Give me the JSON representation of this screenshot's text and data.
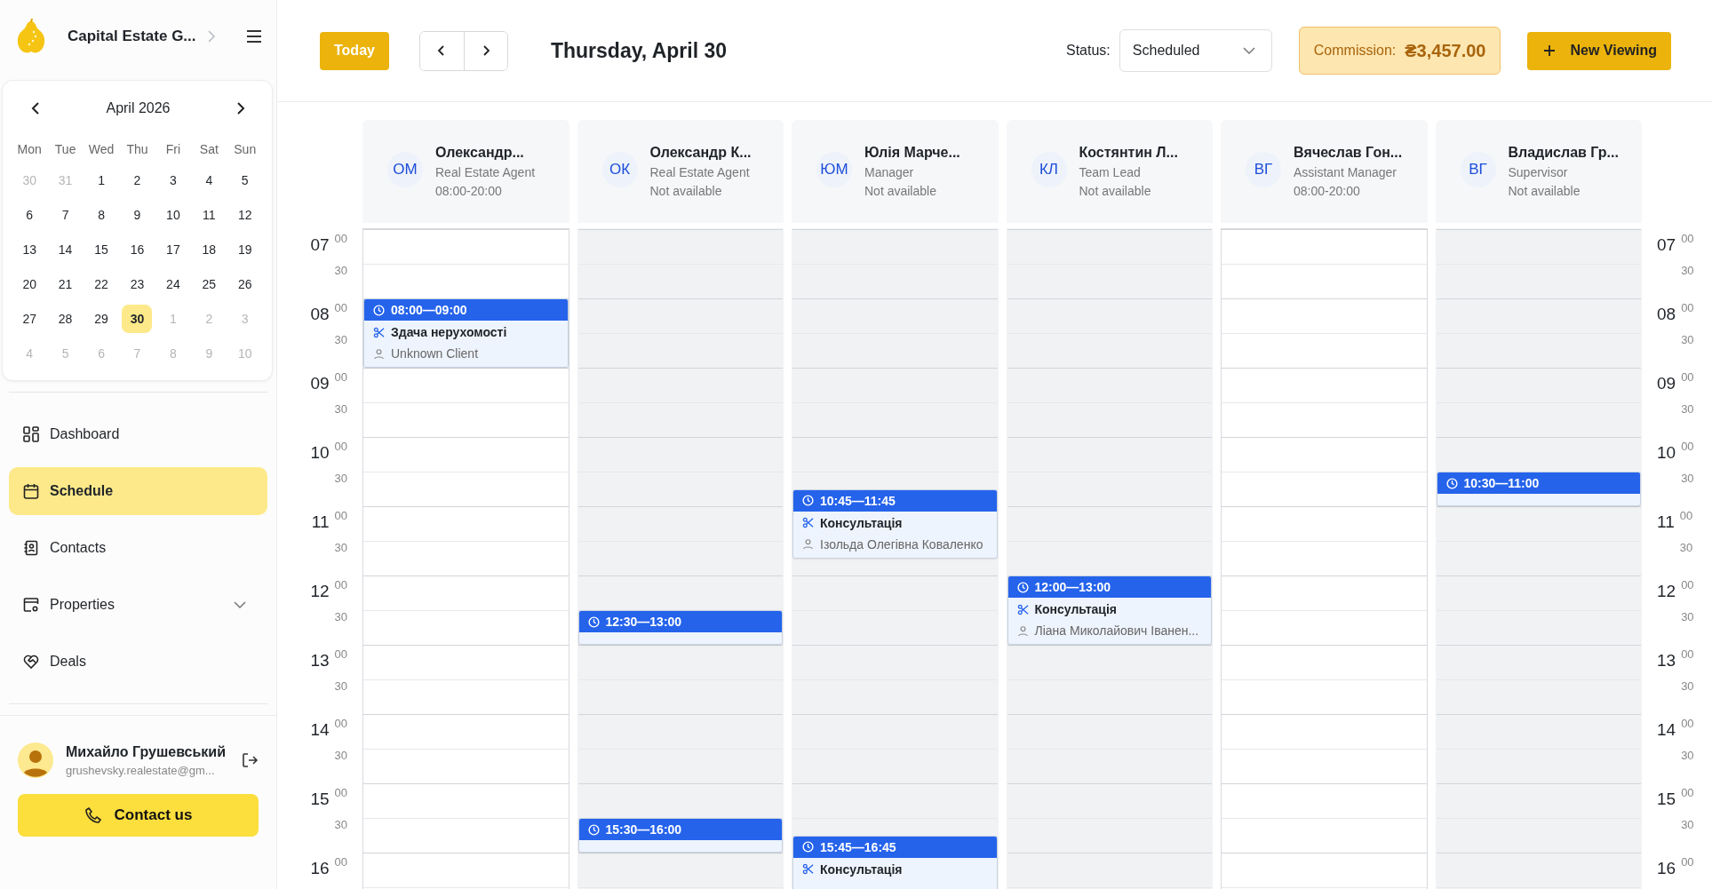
{
  "brand": {
    "name": "Capital Estate G..."
  },
  "calendar": {
    "month": "April 2026",
    "weekdays": [
      "Mon",
      "Tue",
      "Wed",
      "Thu",
      "Fri",
      "Sat",
      "Sun"
    ],
    "weeks": [
      [
        {
          "day": "30",
          "outside": true,
          "selected": false
        },
        {
          "day": "31",
          "outside": true,
          "selected": false
        },
        {
          "day": "1",
          "outside": false,
          "selected": false
        },
        {
          "day": "2",
          "outside": false,
          "selected": false
        },
        {
          "day": "3",
          "outside": false,
          "selected": false
        },
        {
          "day": "4",
          "outside": false,
          "selected": false
        },
        {
          "day": "5",
          "outside": false,
          "selected": false
        }
      ],
      [
        {
          "day": "6",
          "outside": false,
          "selected": false
        },
        {
          "day": "7",
          "outside": false,
          "selected": false
        },
        {
          "day": "8",
          "outside": false,
          "selected": false
        },
        {
          "day": "9",
          "outside": false,
          "selected": false
        },
        {
          "day": "10",
          "outside": false,
          "selected": false
        },
        {
          "day": "11",
          "outside": false,
          "selected": false
        },
        {
          "day": "12",
          "outside": false,
          "selected": false
        }
      ],
      [
        {
          "day": "13",
          "outside": false,
          "selected": false
        },
        {
          "day": "14",
          "outside": false,
          "selected": false
        },
        {
          "day": "15",
          "outside": false,
          "selected": false
        },
        {
          "day": "16",
          "outside": false,
          "selected": false
        },
        {
          "day": "17",
          "outside": false,
          "selected": false
        },
        {
          "day": "18",
          "outside": false,
          "selected": false
        },
        {
          "day": "19",
          "outside": false,
          "selected": false
        }
      ],
      [
        {
          "day": "20",
          "outside": false,
          "selected": false
        },
        {
          "day": "21",
          "outside": false,
          "selected": false
        },
        {
          "day": "22",
          "outside": false,
          "selected": false
        },
        {
          "day": "23",
          "outside": false,
          "selected": false
        },
        {
          "day": "24",
          "outside": false,
          "selected": false
        },
        {
          "day": "25",
          "outside": false,
          "selected": false
        },
        {
          "day": "26",
          "outside": false,
          "selected": false
        }
      ],
      [
        {
          "day": "27",
          "outside": false,
          "selected": false
        },
        {
          "day": "28",
          "outside": false,
          "selected": false
        },
        {
          "day": "29",
          "outside": false,
          "selected": false
        },
        {
          "day": "30",
          "outside": false,
          "selected": true
        },
        {
          "day": "1",
          "outside": true,
          "selected": false
        },
        {
          "day": "2",
          "outside": true,
          "selected": false
        },
        {
          "day": "3",
          "outside": true,
          "selected": false
        }
      ],
      [
        {
          "day": "4",
          "outside": true,
          "selected": false
        },
        {
          "day": "5",
          "outside": true,
          "selected": false
        },
        {
          "day": "6",
          "outside": true,
          "selected": false
        },
        {
          "day": "7",
          "outside": true,
          "selected": false
        },
        {
          "day": "8",
          "outside": true,
          "selected": false
        },
        {
          "day": "9",
          "outside": true,
          "selected": false
        },
        {
          "day": "10",
          "outside": true,
          "selected": false
        }
      ]
    ]
  },
  "nav": [
    {
      "kind": "dashboard",
      "label": "Dashboard",
      "selected": false
    },
    {
      "kind": "schedule",
      "label": "Schedule",
      "selected": true
    },
    {
      "kind": "contacts",
      "label": "Contacts",
      "selected": false
    },
    {
      "kind": "properties",
      "label": "Properties",
      "selected": false,
      "expandable": true
    },
    {
      "kind": "deals",
      "label": "Deals",
      "selected": false
    }
  ],
  "user": {
    "name": "Михайло Грушевський",
    "email": "grushevsky.realestate@gm..."
  },
  "contact_button": "Contact us",
  "toolbar": {
    "today": "Today",
    "date": "Thursday, April 30",
    "status_label": "Status:",
    "status_value": "Scheduled",
    "commission_label": "Commission:",
    "commission_value": "₴3,457.00",
    "new_button": "New Viewing"
  },
  "staff": [
    {
      "initials": "ОМ",
      "name": "Олександр...",
      "role": "Real Estate Agent",
      "hours": "08:00-20:00",
      "available": true,
      "events": [
        {
          "time": "08:00—09:00",
          "title": "Здача нерухомості",
          "client": "Unknown Client"
        }
      ]
    },
    {
      "initials": "ОК",
      "name": "Олександр К...",
      "role": "Real Estate Agent",
      "hours": "Not available",
      "available": false,
      "events": [
        {
          "time": "12:30—13:00"
        },
        {
          "time": "15:30—16:00"
        }
      ]
    },
    {
      "initials": "ЮМ",
      "name": "Юлія Марче...",
      "role": "Manager",
      "hours": "Not available",
      "available": false,
      "events": [
        {
          "time": "10:45—11:45",
          "title": "Консультація",
          "client": "Ізольда Олегівна Коваленко"
        },
        {
          "time": "15:45—16:45",
          "title": "Консультація"
        }
      ]
    },
    {
      "initials": "КЛ",
      "name": "Костянтин Л...",
      "role": "Team Lead",
      "hours": "Not available",
      "available": false,
      "events": [
        {
          "time": "12:00—13:00",
          "title": "Консультація",
          "client": "Ліана Миколайович Іванен..."
        }
      ]
    },
    {
      "initials": "ВГ",
      "name": "Вячеслав Гон...",
      "role": "Assistant Manager",
      "hours": "08:00-20:00",
      "available": true
    },
    {
      "initials": "ВГ",
      "name": "Владислав Гр...",
      "role": "Supervisor",
      "hours": "Not available",
      "available": false,
      "events": [
        {
          "time": "10:30—11:00"
        }
      ]
    }
  ],
  "left_axis": {
    "hours": [
      {
        "hour": "07",
        "minutes": [
          "00",
          "30"
        ]
      },
      {
        "hour": "08",
        "minutes": [
          "00",
          "30"
        ]
      },
      {
        "hour": "09",
        "minutes": [
          "00",
          "30"
        ]
      },
      {
        "hour": "10",
        "minutes": [
          "00",
          "30"
        ]
      },
      {
        "hour": "11",
        "minutes": [
          "00",
          "30"
        ]
      },
      {
        "hour": "12",
        "minutes": [
          "00",
          "30"
        ]
      },
      {
        "hour": "13",
        "minutes": [
          "00",
          "30"
        ]
      },
      {
        "hour": "14",
        "minutes": [
          "00",
          "30"
        ]
      },
      {
        "hour": "15",
        "minutes": [
          "00",
          "30"
        ]
      },
      {
        "hour": "16",
        "minutes": [
          "00"
        ]
      }
    ]
  },
  "right_axis": {
    "hours": [
      {
        "hour": "07",
        "minutes": [
          "00",
          "30"
        ]
      },
      {
        "hour": "08",
        "minutes": [
          "00",
          "30"
        ]
      },
      {
        "hour": "09",
        "minutes": [
          "00",
          "30"
        ]
      },
      {
        "hour": "10",
        "minutes": [
          "00",
          "30"
        ]
      },
      {
        "hour": "11",
        "minutes": [
          "00",
          "30"
        ]
      },
      {
        "hour": "12",
        "minutes": [
          "00",
          "30"
        ]
      },
      {
        "hour": "13",
        "minutes": [
          "00",
          "30"
        ]
      },
      {
        "hour": "14",
        "minutes": [
          "00",
          "30"
        ]
      },
      {
        "hour": "15",
        "minutes": [
          "00",
          "30"
        ]
      },
      {
        "hour": "16",
        "minutes": [
          "00"
        ]
      }
    ]
  }
}
